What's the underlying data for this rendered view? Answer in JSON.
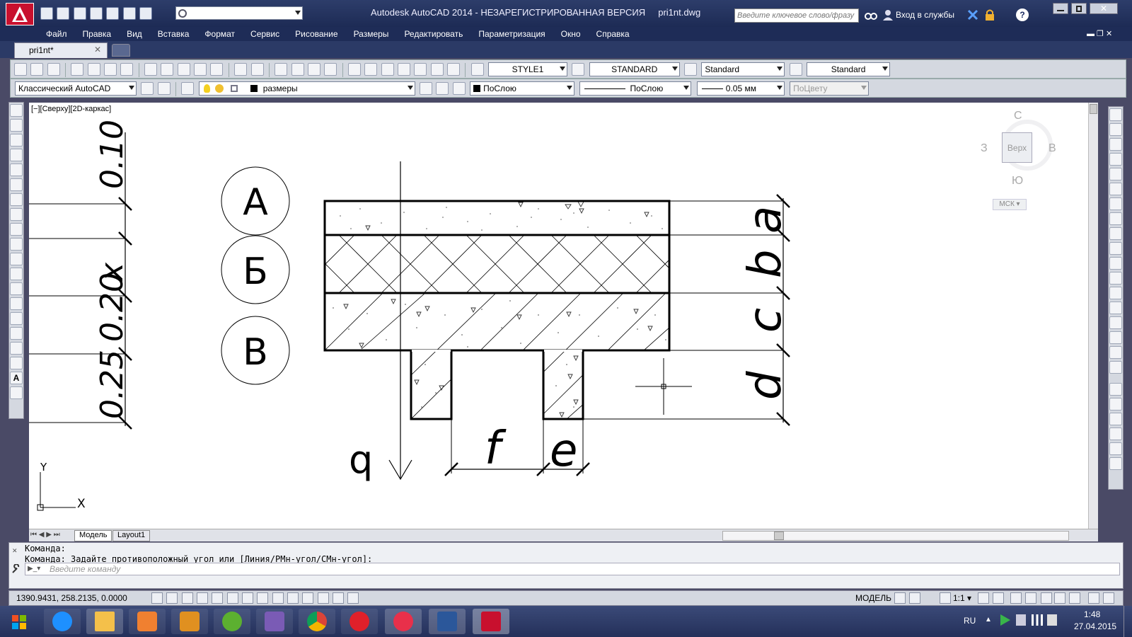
{
  "window": {
    "title": "Autodesk AutoCAD 2014 - НЕЗАРЕГИСТРИРОВАННАЯ ВЕРСИЯ",
    "filename": "pri1nt.dwg",
    "workspace": "Классический AutoCAD",
    "search_placeholder": "Введите ключевое слово/фразу",
    "signin": "Вход в службы"
  },
  "menu": [
    "Файл",
    "Правка",
    "Вид",
    "Вставка",
    "Формат",
    "Сервис",
    "Рисование",
    "Размеры",
    "Редактировать",
    "Параметризация",
    "Окно",
    "Справка"
  ],
  "tabs": [
    {
      "label": "pri1nt*"
    }
  ],
  "toolbar1": {
    "text_style": "STYLE1",
    "dim_style": "STANDARD",
    "table_style": "Standard",
    "mleader_style": "Standard"
  },
  "toolbar2": {
    "workspace": "Классический AutoCAD",
    "layer": "размеры",
    "color": "ПоСлою",
    "linetype": "ПоСлою",
    "lineweight": "0.05 мм",
    "plotstyle": "ПоЦвету"
  },
  "viewport": {
    "label": "[−][Сверху][2D-каркас]"
  },
  "viewcube": {
    "north": "С",
    "south": "Ю",
    "west": "З",
    "east": "В",
    "face": "Верх",
    "ucs": "МСК"
  },
  "ucs": {
    "y": "Y",
    "x": "X"
  },
  "drawing": {
    "left_dims": [
      "0.10",
      "x",
      "0.20",
      "0.25"
    ],
    "circle_labels": [
      "А",
      "Б",
      "В"
    ],
    "right_dims": [
      "a",
      "b",
      "c",
      "d"
    ],
    "bottom_dims": [
      "f",
      "e"
    ],
    "load_label": "q"
  },
  "layout_tabs": [
    "Модель",
    "Layout1"
  ],
  "command": {
    "line1": "Команда:",
    "line2": "Команда: Задайте противоположный угол или [Линия/РМн-угол/СМн-угол]:",
    "placeholder": "Введите команду"
  },
  "status": {
    "coords": "1390.9431, 258.2135, 0.0000",
    "model": "МОДЕЛЬ",
    "scale": "1:1"
  },
  "taskbar": {
    "lang": "RU",
    "time": "1:48",
    "date": "27.04.2015"
  }
}
